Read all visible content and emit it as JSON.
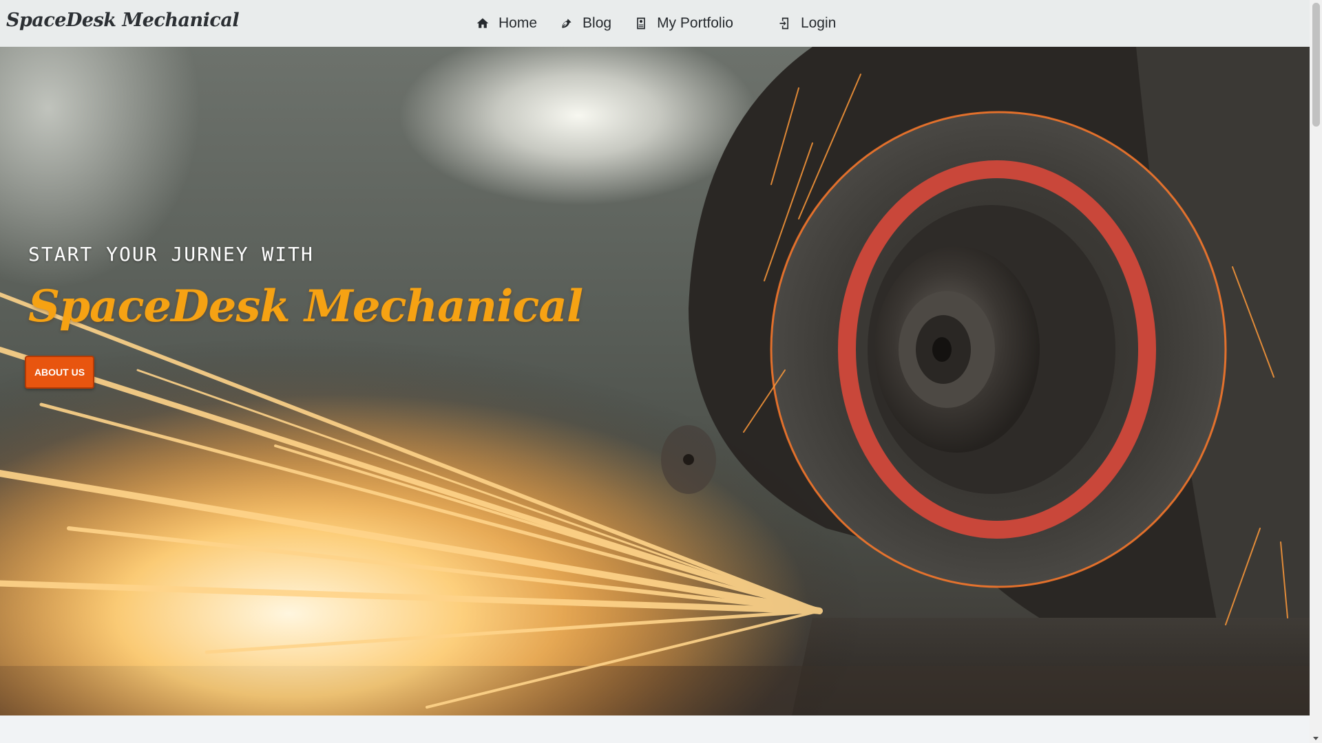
{
  "navbar": {
    "brand": "SpaceDesk Mechanical",
    "links": [
      {
        "label": "Home",
        "icon": "home-icon"
      },
      {
        "label": "Blog",
        "icon": "blog-icon"
      },
      {
        "label": "My Portfolio",
        "icon": "portfolio-icon"
      },
      {
        "label": "Login",
        "icon": "login-icon"
      }
    ]
  },
  "hero": {
    "kicker": "START YOUR JURNEY WITH",
    "title": "SpaceDesk Mechanical",
    "button_label": "ABOUT US"
  },
  "colors": {
    "accent": "#f6a213",
    "button": "#e8550f",
    "navbar_bg": "#e9ecec"
  }
}
